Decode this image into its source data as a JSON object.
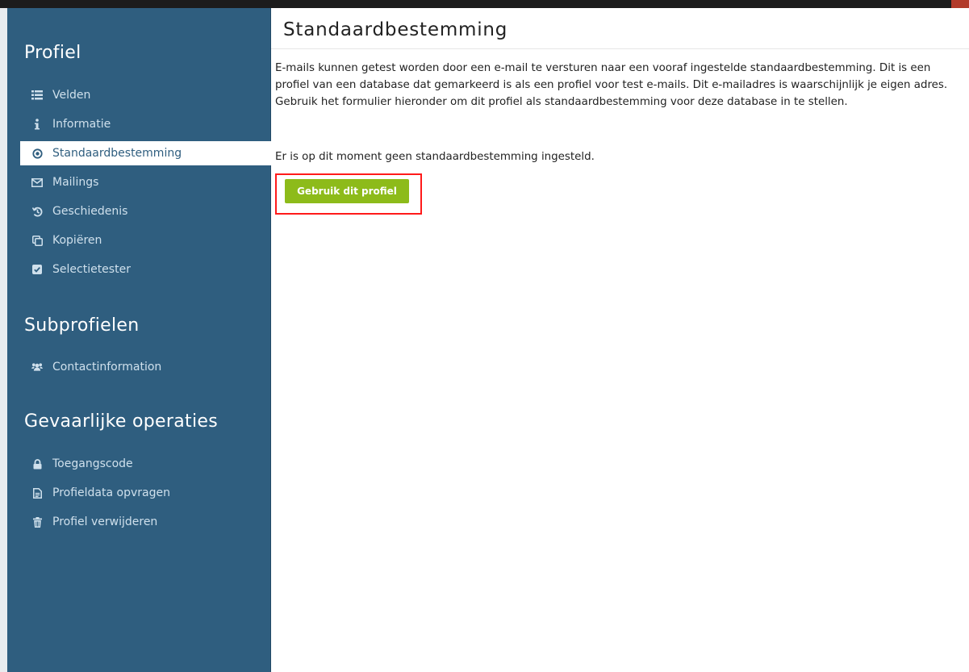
{
  "colors": {
    "sidebar_bg": "#2f5e7f",
    "sidebar_text": "#cfe0ec",
    "active_bg": "#ffffff",
    "button_bg": "#8dbb1a",
    "highlight_border": "#ff1a1a"
  },
  "sidebar": {
    "sections": [
      {
        "title": "Profiel",
        "items": [
          {
            "label": "Velden",
            "icon": "list-icon",
            "active": false
          },
          {
            "label": "Informatie",
            "icon": "info-icon",
            "active": false
          },
          {
            "label": "Standaardbestemming",
            "icon": "target-icon",
            "active": true
          },
          {
            "label": "Mailings",
            "icon": "envelope-icon",
            "active": false
          },
          {
            "label": "Geschiedenis",
            "icon": "history-icon",
            "active": false
          },
          {
            "label": "Kopiëren",
            "icon": "copy-icon",
            "active": false
          },
          {
            "label": "Selectietester",
            "icon": "checkbox-icon",
            "active": false
          }
        ]
      },
      {
        "title": "Subprofielen",
        "items": [
          {
            "label": "Contactinformation",
            "icon": "users-icon",
            "active": false
          }
        ]
      },
      {
        "title": "Gevaarlijke operaties",
        "items": [
          {
            "label": "Toegangscode",
            "icon": "lock-icon",
            "active": false
          },
          {
            "label": "Profieldata opvragen",
            "icon": "document-icon",
            "active": false
          },
          {
            "label": "Profiel verwijderen",
            "icon": "trash-icon",
            "active": false
          }
        ]
      }
    ]
  },
  "main": {
    "title": "Standaardbestemming",
    "intro": "E-mails kunnen getest worden door een e-mail te versturen naar een vooraf ingestelde standaardbestemming. Dit is een profiel van een database dat gemarkeerd is als een profiel voor test e-mails. Dit e-mailadres is waarschijnlijk je eigen adres. Gebruik het formulier hieronder om dit profiel als standaardbestemming voor deze database in te stellen.",
    "status": "Er is op dit moment geen standaardbestemming ingesteld.",
    "button_label": "Gebruik dit profiel"
  }
}
